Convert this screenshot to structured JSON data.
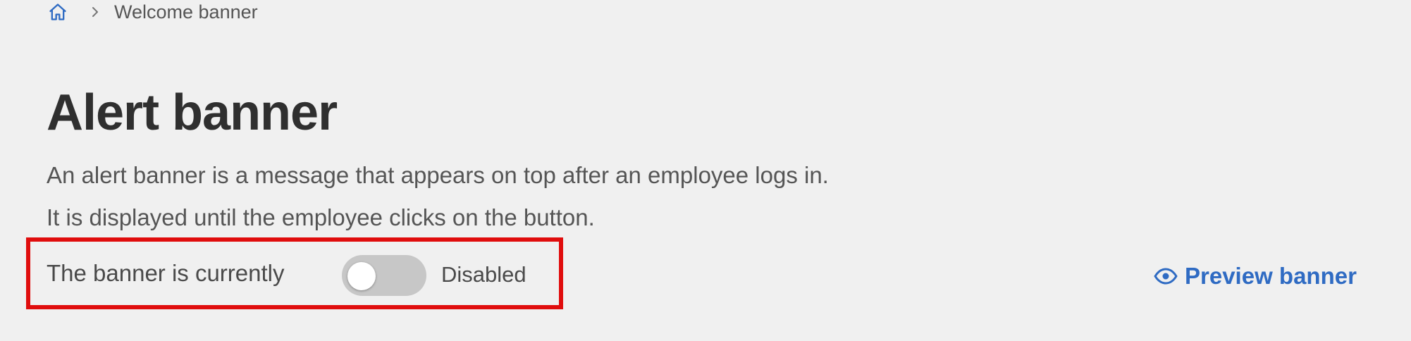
{
  "breadcrumb": {
    "home_icon": "home-icon",
    "separator_icon": "chevron-right-icon",
    "current": "Welcome banner"
  },
  "page": {
    "title": "Alert banner",
    "description_line1": "An alert banner is a message that appears on top after an employee logs in.",
    "description_line2": "It is displayed until the employee clicks on the button."
  },
  "status": {
    "label": "The banner is currently",
    "toggle_on": false,
    "state_text": "Disabled"
  },
  "preview": {
    "icon": "eye-icon",
    "label": "Preview banner"
  },
  "colors": {
    "background": "#f0f0f0",
    "link": "#2f6bc3",
    "highlight": "#e00d0d",
    "toggle_off": "#c7c7c7"
  }
}
